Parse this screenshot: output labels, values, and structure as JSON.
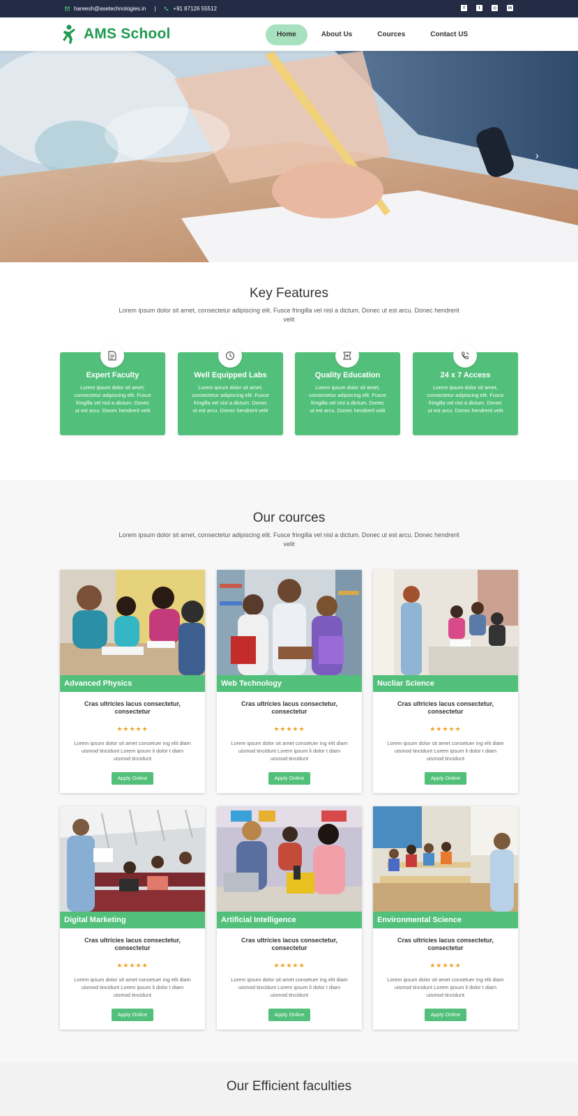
{
  "topbar": {
    "email": "hareesh@asetechnologies.in",
    "separator": "|",
    "phone": "+91 87126 55512",
    "social": [
      {
        "icon": "facebook-icon",
        "glyph": "f"
      },
      {
        "icon": "twitter-icon",
        "glyph": "t"
      },
      {
        "icon": "instagram-icon",
        "glyph": "◎"
      },
      {
        "icon": "linkedin-icon",
        "glyph": "in"
      }
    ],
    "colors": {
      "background": "#232b45",
      "icon_accent": "#4cd87c"
    }
  },
  "header": {
    "logo_text": "AMS School",
    "logo_color": "#1f9a4f",
    "nav": [
      "Home",
      "About Us",
      "Cources",
      "Contact US"
    ],
    "active_nav": "Home",
    "active_color": "#a7e1bf"
  },
  "hero": {
    "next_arrow": "›",
    "image_subject": "student-writing-exam-photo"
  },
  "features": {
    "title": "Key Features",
    "subtitle": "Lorem ipsum dolor sit amet, consectetur adipiscing elit. Fusce fringilla vel nisl a dictum. Donec ut est arcu. Donec hendrerit velit",
    "accent": "#52c07a",
    "cards": [
      {
        "icon": "document-icon",
        "title": "Expert Faculty",
        "text": "Lorem ipsum dolor sit amet, consectetur adipiscing elit. Fusce fringilla vel nisl a dictum. Donec ut est arcu. Donec hendrerit velit"
      },
      {
        "icon": "clock-icon",
        "title": "Well Equipped Labs",
        "text": "Lorem ipsum dolor sit amet, consectetur adipiscing elit. Fusce fringilla vel nisl a dictum. Donec ut est arcu. Donec hendrerit velit"
      },
      {
        "icon": "frame-icon",
        "title": "Quality Education",
        "text": "Lorem ipsum dolor sit amet, consectetur adipiscing elit. Fusce fringilla vel nisl a dictum. Donec ut est arcu. Donec hendrerit velit"
      },
      {
        "icon": "phone-icon",
        "title": "24 x 7 Access",
        "text": "Lorem ipsum dolor sit amet, consectetur adipiscing elit. Fusce fringilla vel nisl a dictum. Donec ut est arcu. Donec hendrerit velit"
      }
    ]
  },
  "courses": {
    "title": "Our cources",
    "subtitle": "Lorem ipsum dolor sit amet, consectetur adipiscing elit. Fusce fringilla vel nisl a dictum. Donec ut est arcu. Donec hendrerit velit",
    "items": [
      {
        "name": "Advanced Physics",
        "subtitle": "Cras ultricies lacus consectetur, consectetur",
        "rating": 5,
        "stars": "★★★★★",
        "description": "Lorem ipsum dolor sit amet consetuer ing elit diam uismod tincidunt Lorem ipsum li dolor t diam uismod tincidunt",
        "button": "Apply Online"
      },
      {
        "name": "Web Technology",
        "subtitle": "Cras ultricies lacus consectetur, consectetur",
        "rating": 5,
        "stars": "★★★★★",
        "description": "Lorem ipsum dolor sit amet consetuer ing elit diam uismod tincidunt Lorem ipsum li dolor t diam uismod tincidunt",
        "button": "Apply Online"
      },
      {
        "name": "Nucliar Science",
        "subtitle": "Cras ultricies lacus consectetur, consectetur",
        "rating": 5,
        "stars": "★★★★★",
        "description": "Lorem ipsum dolor sit amet consetuer ing elit diam uismod tincidunt Lorem ipsum li dolor t diam uismod tincidunt",
        "button": "Apply Online"
      },
      {
        "name": "Digital Marketing",
        "subtitle": "Cras ultricies lacus consectetur, consectetur",
        "rating": 5,
        "stars": "★★★★★",
        "description": "Lorem ipsum dolor sit amet consetuer ing elit diam uismod tincidunt Lorem ipsum li dolor t diam uismod tincidunt",
        "button": "Apply Online"
      },
      {
        "name": "Artificial Intelligence",
        "subtitle": "Cras ultricies lacus consectetur, consectetur",
        "rating": 5,
        "stars": "★★★★★",
        "description": "Lorem ipsum dolor sit amet consetuer ing elit diam uismod tincidunt Lorem ipsum li dolor t diam uismod tincidunt",
        "button": "Apply Online"
      },
      {
        "name": "Environmental Science",
        "subtitle": "Cras ultricies lacus consectetur, consectetur",
        "rating": 5,
        "stars": "★★★★★",
        "description": "Lorem ipsum dolor sit amet consetuer ing elit diam uismod tincidunt Lorem ipsum li dolor t diam uismod tincidunt",
        "button": "Apply Online"
      }
    ]
  },
  "faculties": {
    "title": "Our Efficient faculties"
  }
}
